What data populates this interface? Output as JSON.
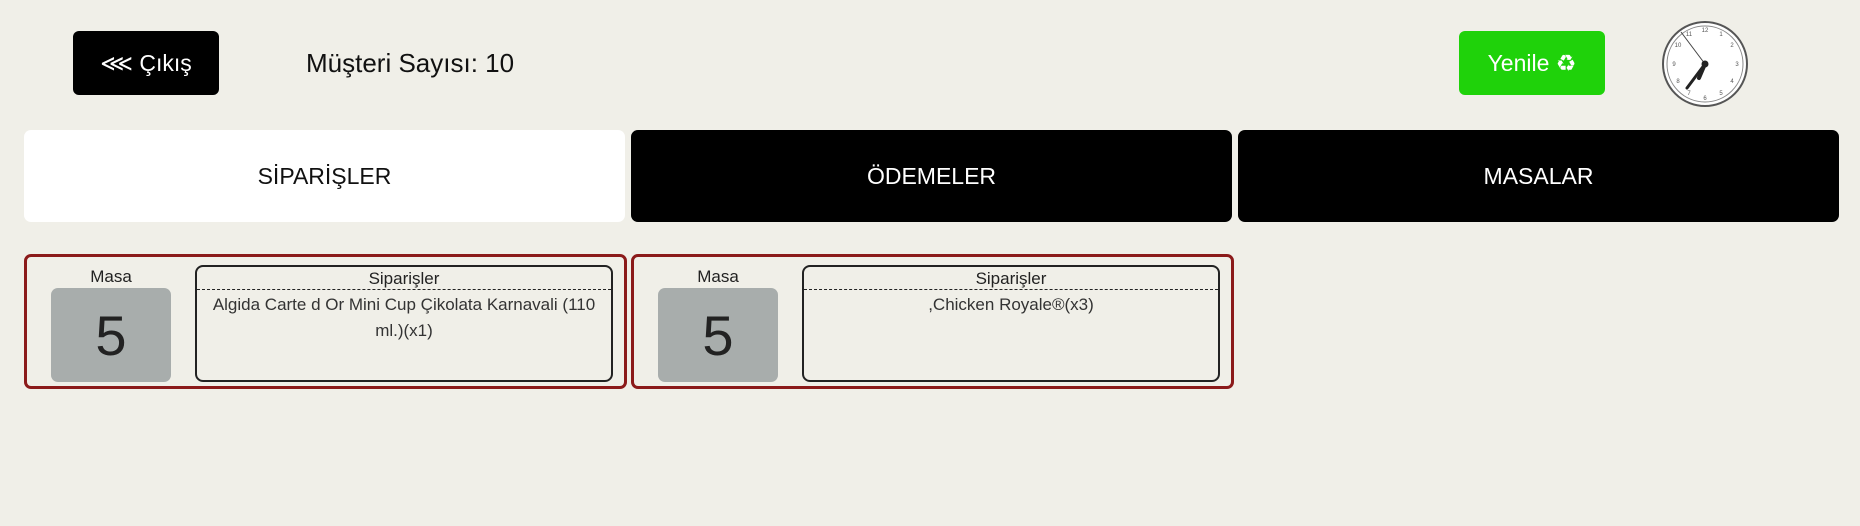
{
  "header": {
    "exit_label": "⋘ Çıkış",
    "customer_count": "Müşteri Sayısı: 10",
    "refresh_label": "Yenile ♻"
  },
  "tabs": [
    {
      "label": "SİPARİŞLER",
      "active": true
    },
    {
      "label": "ÖDEMELER",
      "active": false
    },
    {
      "label": "MASALAR",
      "active": false
    }
  ],
  "orders": [
    {
      "table_label": "Masa",
      "table_number": "5",
      "orders_header": "Siparişler",
      "orders_text": "Algida Carte d Or Mini Cup Çikolata Karnavali (110 ml.)(x1)"
    },
    {
      "table_label": "Masa",
      "table_number": "5",
      "orders_header": "Siparişler",
      "orders_text": ",Chicken Royale®(x3)"
    }
  ],
  "colors": {
    "background": "#f0efe8",
    "refresh": "#1fd20a",
    "card_border": "#8b1a1a",
    "table_box": "#a8adac"
  }
}
